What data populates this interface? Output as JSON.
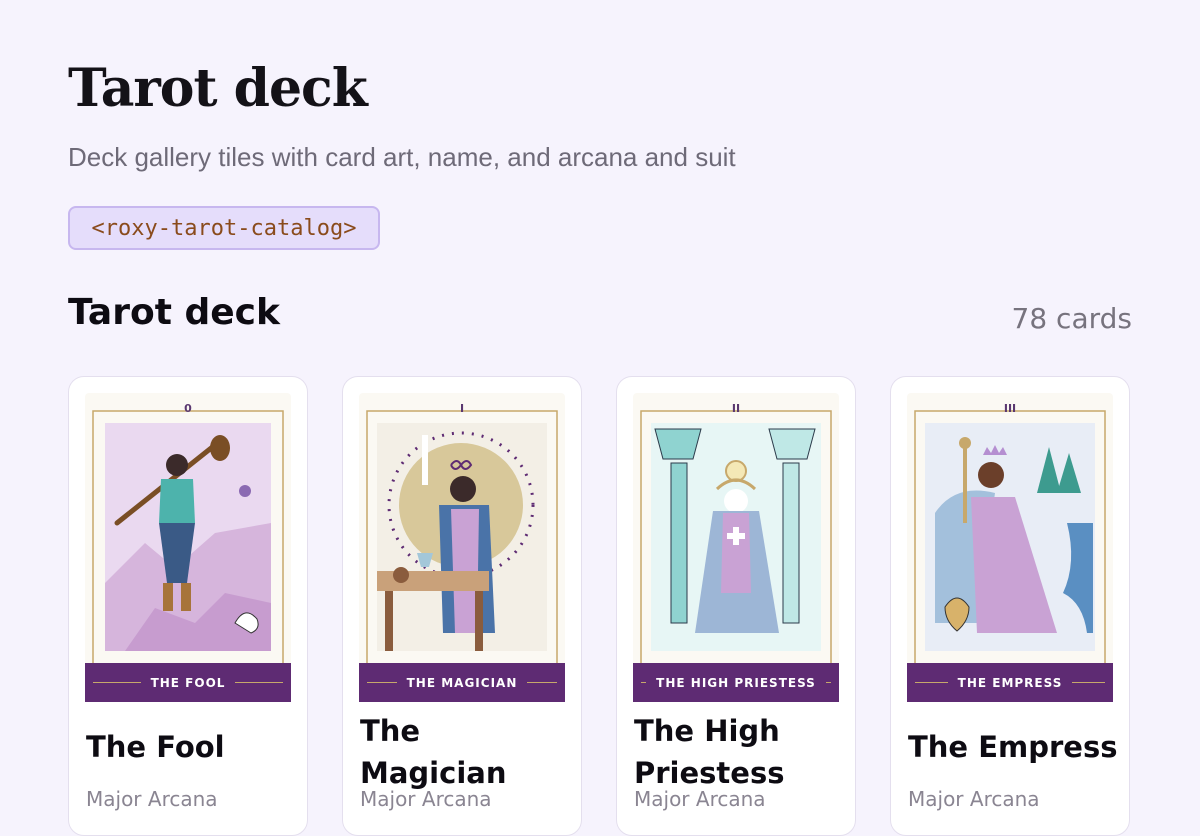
{
  "header": {
    "title": "Tarot deck",
    "subtitle": "Deck gallery tiles with card art, name, and arcana and suit",
    "tag": "<roxy-tarot-catalog>"
  },
  "section": {
    "title": "Tarot deck",
    "count": "78 cards"
  },
  "cards": [
    {
      "numeral": "0",
      "band": "THE FOOL",
      "name": "The Fool",
      "meta": "Major Arcana",
      "art_color": "#e9d9ef"
    },
    {
      "numeral": "I",
      "band": "THE MAGICIAN",
      "name": "The Magician",
      "meta": "Major Arcana",
      "art_color": "#f3efe6"
    },
    {
      "numeral": "II",
      "band": "THE HIGH PRIESTESS",
      "name": "The High Priestess",
      "meta": "Major Arcana",
      "art_color": "#e7f6f5"
    },
    {
      "numeral": "III",
      "band": "THE EMPRESS",
      "name": "The Empress",
      "meta": "Major Arcana",
      "art_color": "#e8edf6"
    }
  ],
  "colors": {
    "background": "#f6f3fd",
    "band": "#5e2b73",
    "gold": "#c7a86b",
    "tag_bg": "#e5ddfb"
  }
}
